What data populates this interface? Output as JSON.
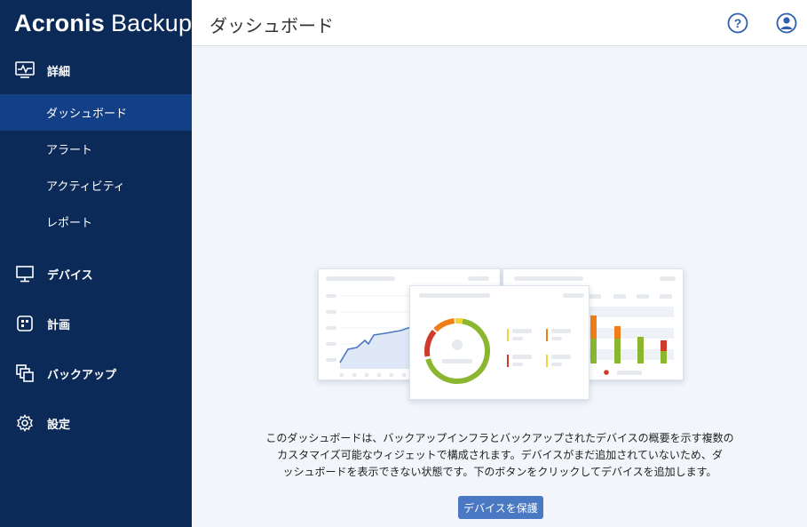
{
  "brand": {
    "name_bold": "Acronis",
    "name_light": "Backup"
  },
  "header": {
    "title": "ダッシュボード"
  },
  "sidebar": {
    "sections": [
      {
        "label": "詳細",
        "icon": "monitor-pulse-icon"
      },
      {
        "label": "デバイス",
        "icon": "desktop-icon"
      },
      {
        "label": "計画",
        "icon": "plan-icon"
      },
      {
        "label": "バックアップ",
        "icon": "backup-copies-icon"
      },
      {
        "label": "設定",
        "icon": "gear-icon"
      }
    ],
    "sub_items": [
      {
        "label": "ダッシュボード",
        "active": true
      },
      {
        "label": "アラート",
        "active": false
      },
      {
        "label": "アクティビティ",
        "active": false
      },
      {
        "label": "レポート",
        "active": false
      }
    ]
  },
  "main": {
    "description_lines": [
      "このダッシュボードは、バックアップインフラとバックアップされたデバイスの概要を示す複数の",
      "カスタマイズ可能なウィジェットで構成されます。デバイスがまだ追加されていないため、ダ",
      "ッシュボードを表示できない状態です。下のボタンをクリックしてデバイスを追加します。"
    ],
    "protect_button": "デバイスを保護"
  },
  "colors": {
    "sidebar_bg": "#0b2a58",
    "sidebar_active": "#133f86",
    "accent_blue": "#4a78c2",
    "chart_green": "#8ab72f",
    "chart_red": "#d03a2b",
    "chart_orange": "#f07d17",
    "chart_yellow": "#f3d33a"
  }
}
